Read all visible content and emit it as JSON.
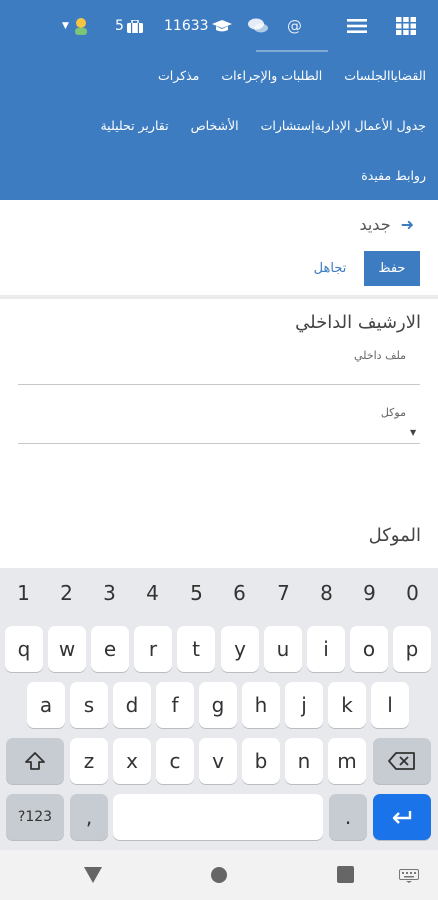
{
  "header": {
    "points": "11633",
    "count": "5",
    "nav_row1": [
      "القضايا",
      "الجلسات",
      "الطلبات والإجراءات",
      "مذكرات"
    ],
    "nav_row2": [
      "جدول الأعمال الإدارية",
      "إستشارات",
      "الأشخاص",
      "تقارير تحليلية"
    ],
    "nav_row3": [
      "روابط مفيدة"
    ]
  },
  "page": {
    "title": "جديد",
    "save_label": "حفظ",
    "ignore_label": "تجاهل"
  },
  "form": {
    "section1_title": "الارشيف الداخلي",
    "field1_label": "ملف داخلي",
    "field2_label": "موكل",
    "section2_title": "الموكل"
  },
  "keyboard": {
    "numbers": [
      "1",
      "2",
      "3",
      "4",
      "5",
      "6",
      "7",
      "8",
      "9",
      "0"
    ],
    "row1": [
      "q",
      "w",
      "e",
      "r",
      "t",
      "y",
      "u",
      "i",
      "o",
      "p"
    ],
    "row2": [
      "a",
      "s",
      "d",
      "f",
      "g",
      "h",
      "j",
      "k",
      "l"
    ],
    "row3": [
      "z",
      "x",
      "c",
      "v",
      "b",
      "n",
      "m"
    ],
    "symbols_label": "?123",
    "comma": ",",
    "period": "."
  },
  "colors": {
    "header_bg": "#3d7cc1",
    "enter_key": "#1a73e8"
  }
}
